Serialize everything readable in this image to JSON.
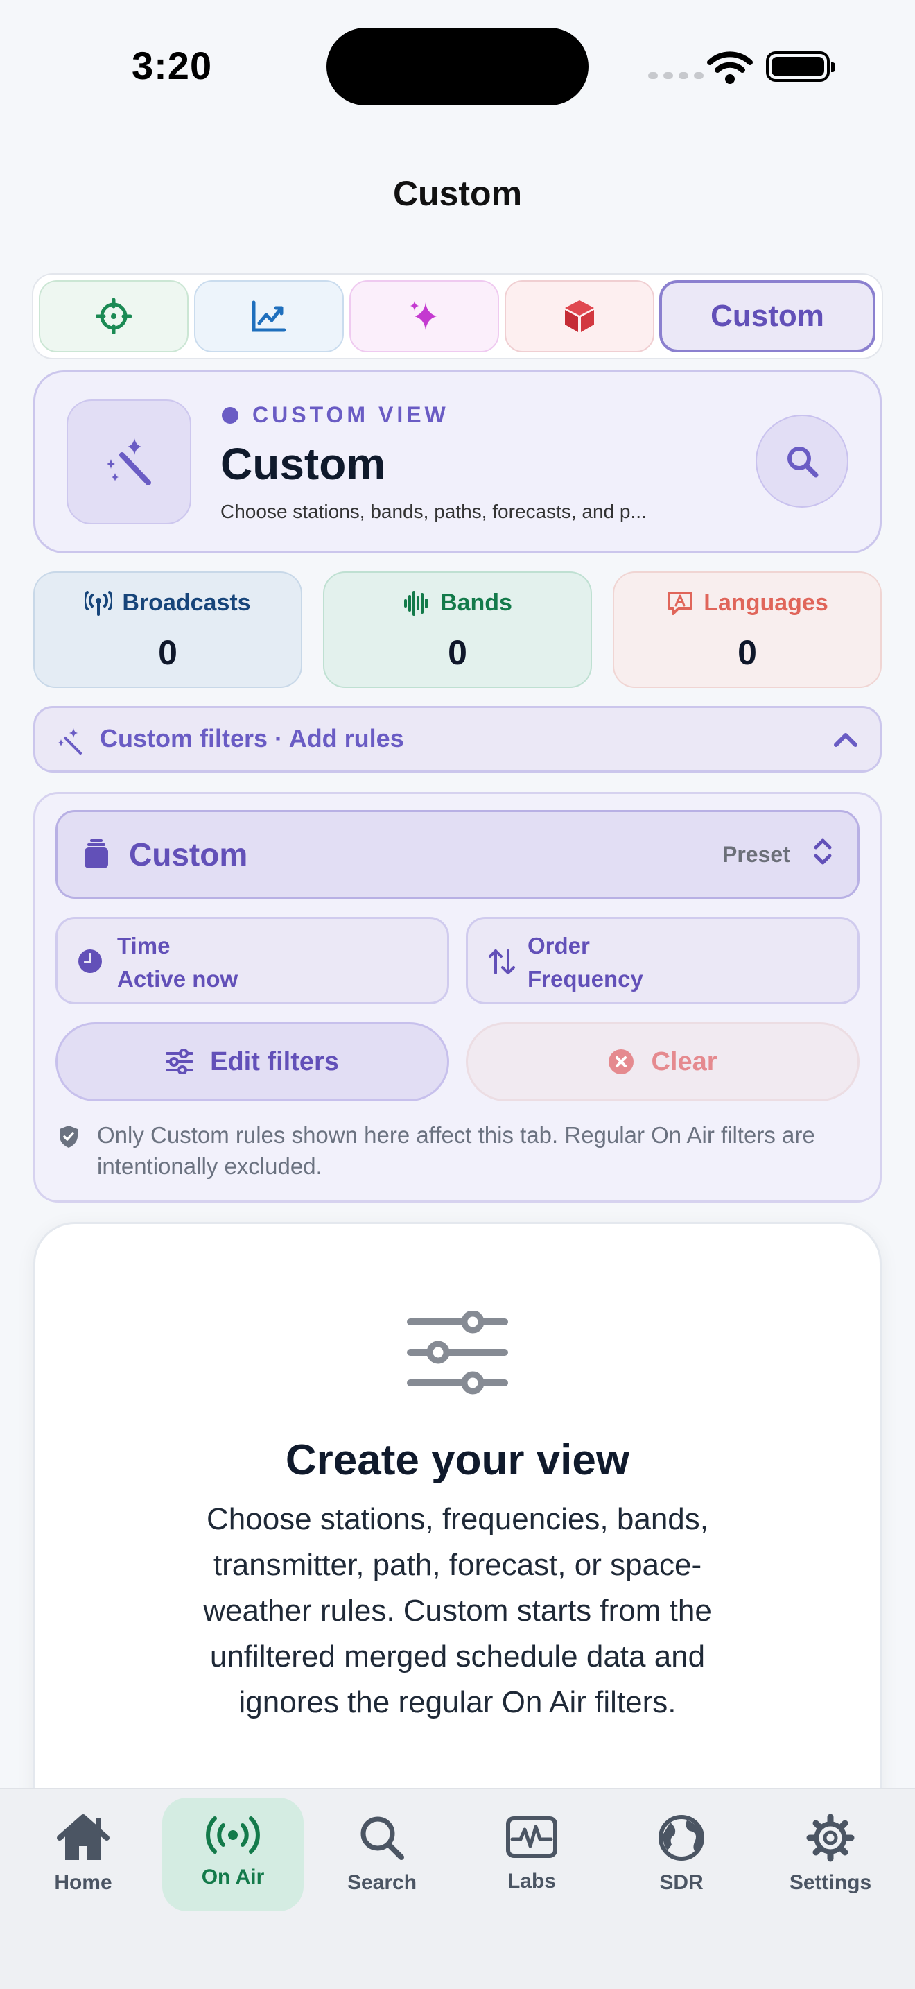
{
  "status_bar": {
    "time": "3:20"
  },
  "header": {
    "title": "Custom"
  },
  "segments": [
    {
      "icon": "crosshair-icon",
      "color": "#1b8a54"
    },
    {
      "icon": "trend-chart-icon",
      "color": "#1f6fbd"
    },
    {
      "icon": "sparkles-icon",
      "color": "#c43ad0"
    },
    {
      "icon": "cube-icon",
      "color": "#d23840"
    },
    {
      "label": "Custom",
      "selected": true
    }
  ],
  "hero": {
    "icon": "magic-wand-icon",
    "eyebrow": "CUSTOM VIEW",
    "title": "Custom",
    "description": "Choose stations, bands, paths, forecasts, and p...",
    "search_icon": "search-icon"
  },
  "stats": {
    "broadcasts": {
      "label": "Broadcasts",
      "value": "0",
      "icon": "antenna-icon"
    },
    "bands": {
      "label": "Bands",
      "value": "0",
      "icon": "waveform-icon"
    },
    "languages": {
      "label": "Languages",
      "value": "0",
      "icon": "language-bubble-icon"
    }
  },
  "filter_bar": {
    "label": "Custom filters · Add rules",
    "expanded": true
  },
  "filter_panel": {
    "preset": {
      "label": "Custom",
      "right_label": "Preset"
    },
    "time": {
      "title": "Time",
      "value": "Active now"
    },
    "order": {
      "title": "Order",
      "value": "Frequency"
    },
    "edit_button": "Edit filters",
    "clear_button": "Clear",
    "note": "Only Custom rules shown here affect this tab. Regular On Air filters are intentionally excluded."
  },
  "empty_state": {
    "icon": "sliders-icon",
    "title": "Create your view",
    "description": "Choose stations, frequencies, bands, transmitter, path, forecast, or space-weather rules. Custom starts from the unfiltered merged schedule data and ignores the regular On Air filters."
  },
  "tab_bar": {
    "items": [
      {
        "label": "Home",
        "icon": "house-icon"
      },
      {
        "label": "On Air",
        "icon": "broadcast-icon",
        "selected": true
      },
      {
        "label": "Search",
        "icon": "search-icon"
      },
      {
        "label": "Labs",
        "icon": "waveform-monitor-icon"
      },
      {
        "label": "SDR",
        "icon": "globe-icon"
      },
      {
        "label": "Settings",
        "icon": "gear-icon"
      }
    ]
  },
  "colors": {
    "accent": "#6250b8",
    "onair_green": "#137a4a",
    "clear_red": "#e58a8f"
  }
}
